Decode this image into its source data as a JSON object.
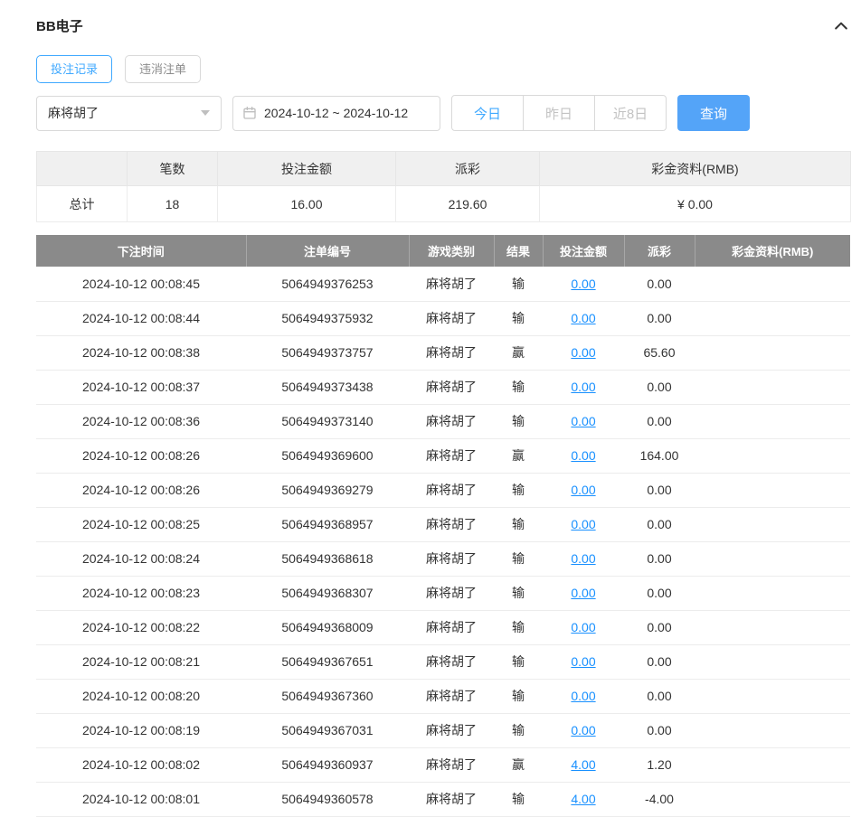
{
  "panel": {
    "title": "BB电子"
  },
  "tabs": [
    {
      "label": "投注记录",
      "active": true
    },
    {
      "label": "违消注单",
      "active": false
    }
  ],
  "filters": {
    "game_select": "麻将胡了",
    "date_range": "2024-10-12 ~ 2024-10-12",
    "quick_buttons": [
      {
        "label": "今日",
        "active": true
      },
      {
        "label": "昨日",
        "active": false
      },
      {
        "label": "近8日",
        "active": false
      }
    ],
    "search_label": "查询"
  },
  "summary": {
    "headers": [
      "",
      "笔数",
      "投注金额",
      "派彩",
      "彩金资料(RMB)"
    ],
    "total_label": "总计",
    "count": "18",
    "bet_amount": "16.00",
    "payout": "219.60",
    "bonus": "¥ 0.00"
  },
  "table": {
    "headers": [
      "下注时间",
      "注单编号",
      "游戏类别",
      "结果",
      "投注金额",
      "派彩",
      "彩金资料(RMB)"
    ],
    "rows": [
      {
        "time": "2024-10-12 00:08:45",
        "order": "5064949376253",
        "game": "麻将胡了",
        "result": "输",
        "bet": "0.00",
        "payout": "0.00",
        "bonus": ""
      },
      {
        "time": "2024-10-12 00:08:44",
        "order": "5064949375932",
        "game": "麻将胡了",
        "result": "输",
        "bet": "0.00",
        "payout": "0.00",
        "bonus": ""
      },
      {
        "time": "2024-10-12 00:08:38",
        "order": "5064949373757",
        "game": "麻将胡了",
        "result": "赢",
        "bet": "0.00",
        "payout": "65.60",
        "bonus": ""
      },
      {
        "time": "2024-10-12 00:08:37",
        "order": "5064949373438",
        "game": "麻将胡了",
        "result": "输",
        "bet": "0.00",
        "payout": "0.00",
        "bonus": ""
      },
      {
        "time": "2024-10-12 00:08:36",
        "order": "5064949373140",
        "game": "麻将胡了",
        "result": "输",
        "bet": "0.00",
        "payout": "0.00",
        "bonus": ""
      },
      {
        "time": "2024-10-12 00:08:26",
        "order": "5064949369600",
        "game": "麻将胡了",
        "result": "赢",
        "bet": "0.00",
        "payout": "164.00",
        "bonus": ""
      },
      {
        "time": "2024-10-12 00:08:26",
        "order": "5064949369279",
        "game": "麻将胡了",
        "result": "输",
        "bet": "0.00",
        "payout": "0.00",
        "bonus": ""
      },
      {
        "time": "2024-10-12 00:08:25",
        "order": "5064949368957",
        "game": "麻将胡了",
        "result": "输",
        "bet": "0.00",
        "payout": "0.00",
        "bonus": ""
      },
      {
        "time": "2024-10-12 00:08:24",
        "order": "5064949368618",
        "game": "麻将胡了",
        "result": "输",
        "bet": "0.00",
        "payout": "0.00",
        "bonus": ""
      },
      {
        "time": "2024-10-12 00:08:23",
        "order": "5064949368307",
        "game": "麻将胡了",
        "result": "输",
        "bet": "0.00",
        "payout": "0.00",
        "bonus": ""
      },
      {
        "time": "2024-10-12 00:08:22",
        "order": "5064949368009",
        "game": "麻将胡了",
        "result": "输",
        "bet": "0.00",
        "payout": "0.00",
        "bonus": ""
      },
      {
        "time": "2024-10-12 00:08:21",
        "order": "5064949367651",
        "game": "麻将胡了",
        "result": "输",
        "bet": "0.00",
        "payout": "0.00",
        "bonus": ""
      },
      {
        "time": "2024-10-12 00:08:20",
        "order": "5064949367360",
        "game": "麻将胡了",
        "result": "输",
        "bet": "0.00",
        "payout": "0.00",
        "bonus": ""
      },
      {
        "time": "2024-10-12 00:08:19",
        "order": "5064949367031",
        "game": "麻将胡了",
        "result": "输",
        "bet": "0.00",
        "payout": "0.00",
        "bonus": ""
      },
      {
        "time": "2024-10-12 00:08:02",
        "order": "5064949360937",
        "game": "麻将胡了",
        "result": "赢",
        "bet": "4.00",
        "payout": "1.20",
        "bonus": ""
      },
      {
        "time": "2024-10-12 00:08:01",
        "order": "5064949360578",
        "game": "麻将胡了",
        "result": "输",
        "bet": "4.00",
        "payout": "-4.00",
        "bonus": ""
      }
    ]
  },
  "colors": {
    "accent_blue": "#40a9ff",
    "button_blue": "#54a4f8",
    "link_blue": "#1890ff",
    "negative_red": "#f5222d",
    "table_header_gray": "#8a8a8a"
  }
}
